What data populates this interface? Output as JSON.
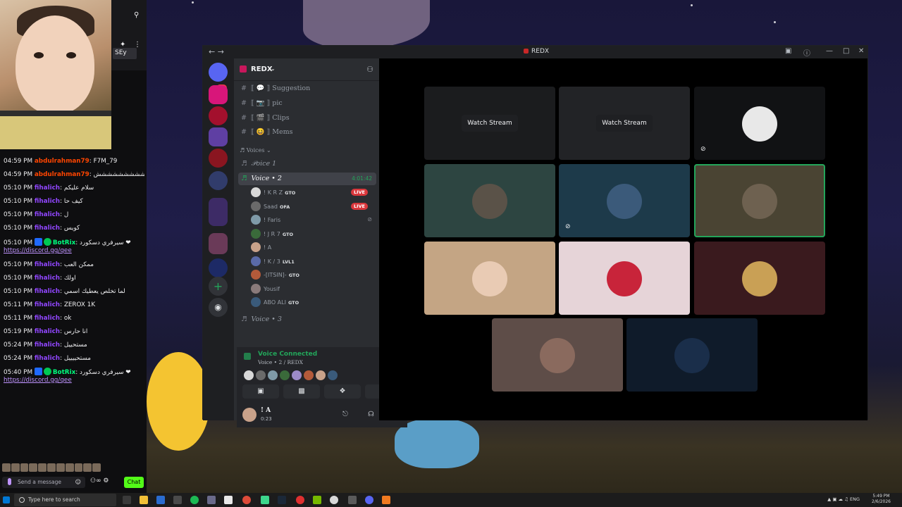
{
  "twitch_chat": {
    "messages": [
      {
        "time": "04:59 PM",
        "user": "abdulrahman79",
        "text": "F7M_79"
      },
      {
        "time": "04:59 PM",
        "user": "abdulrahman79",
        "text": "شششششششششششش"
      },
      {
        "time": "05:10 PM",
        "user": "fihalich",
        "text": "سلام عليكم"
      },
      {
        "time": "05:10 PM",
        "user": "fihalich",
        "text": "كيف حا"
      },
      {
        "time": "05:10 PM",
        "user": "fihalich",
        "text": "ل"
      },
      {
        "time": "05:10 PM",
        "user": "fihalich",
        "text": "كويس"
      },
      {
        "time": "05:10 PM",
        "user": "BotRix",
        "text": "سيرفري دسكورد ❤",
        "link": "https://discord.gg/qee"
      },
      {
        "time": "05:10 PM",
        "user": "fihalich",
        "text": "ممكن العب"
      },
      {
        "time": "05:10 PM",
        "user": "fihalich",
        "text": "اولك"
      },
      {
        "time": "05:10 PM",
        "user": "fihalich",
        "text": "لما تخلص يعطيك اسمي"
      },
      {
        "time": "05:11 PM",
        "user": "fihalich",
        "text": "ZEROX 1K"
      },
      {
        "time": "05:11 PM",
        "user": "fihalich",
        "text": "ok"
      },
      {
        "time": "05:19 PM",
        "user": "fihalich",
        "text": "انا حارس"
      },
      {
        "time": "05:24 PM",
        "user": "fihalich",
        "text": "مستحييل"
      },
      {
        "time": "05:24 PM",
        "user": "fihalich",
        "text": "مستحييييل"
      },
      {
        "time": "05:40 PM",
        "user": "BotRix",
        "text": "سيرفري دسكورد ❤",
        "link": "https://discord.gg/qee"
      }
    ],
    "send_placeholder": "Send a message",
    "chat_button": "Chat",
    "viewer_label": "SEy"
  },
  "discord": {
    "window_title": "REDX",
    "unread_count": "12",
    "server_name": "REDX",
    "text_channels": [
      {
        "name": "Suggestion",
        "prefix": "⟦ 💬 ⟧"
      },
      {
        "name": "pic",
        "prefix": "⟦ 📷 ⟧"
      },
      {
        "name": "Clips",
        "prefix": "⟦ 🎬 ⟧"
      },
      {
        "name": "Mems",
        "prefix": "⟦ 😆 ⟧"
      }
    ],
    "voice_category": "Voices",
    "voice_channels": [
      {
        "name": "𝒫𝑜𝑖𝑐𝑒 1",
        "label": "Voice • 1"
      },
      {
        "name": "Voice • 2",
        "duration": "4:01:42"
      },
      {
        "name": "Voice • 3"
      }
    ],
    "voice_users": [
      {
        "name": "! K R Z",
        "tag": "GTO",
        "live": "LIVE"
      },
      {
        "name": "Saad",
        "tag": "OFA",
        "live": "LIVE"
      },
      {
        "name": "! Faris",
        "tag": ""
      },
      {
        "name": "! J R 7",
        "tag": "GTO"
      },
      {
        "name": "! A",
        "tag": ""
      },
      {
        "name": "! K / 3",
        "tag": "LVL1"
      },
      {
        "name": "-[ITSIN]-",
        "tag": "GTO"
      },
      {
        "name": "Yousif",
        "tag": ""
      },
      {
        "name": "ABO ALI",
        "tag": "GTO"
      }
    ],
    "voice_panel": {
      "status": "Voice Connected",
      "location": "Voice • 2 / REDX"
    },
    "user": {
      "name": "! A",
      "status": "0:23"
    },
    "stage_tiles": [
      {
        "type": "stream",
        "label": "Watch Stream",
        "bg": "#1b1c1e"
      },
      {
        "type": "stream",
        "label": "Watch Stream",
        "bg": "#222326"
      },
      {
        "type": "user",
        "bg": "#111214",
        "avatar": "#e8e8e8",
        "muted": true
      },
      {
        "type": "user",
        "bg": "#2d4541",
        "avatar": "#5a5248"
      },
      {
        "type": "user",
        "bg": "#1d3a4a",
        "avatar": "#3b5a7a",
        "muted": true
      },
      {
        "type": "user",
        "bg": "#4a4433",
        "avatar": "#6e6150",
        "speaking": true
      },
      {
        "type": "user",
        "bg": "#c4a584",
        "avatar": "#e9cbb4"
      },
      {
        "type": "user",
        "bg": "#e6d4d8",
        "avatar": "#c8243a"
      },
      {
        "type": "user",
        "bg": "#3a1a1e",
        "avatar": "#c9a055"
      },
      {
        "type": "user",
        "bg": "#5e4d48",
        "avatar": "#8a6a5e"
      },
      {
        "type": "user",
        "bg": "#0f1b2a",
        "avatar": "#1a2e4a"
      }
    ]
  },
  "taskbar": {
    "search_placeholder": "Type here to search",
    "language": "ENG",
    "time": "5:49 PM",
    "date": "2/6/2026"
  },
  "colors": {
    "discord_green": "#23a55a",
    "live_red": "#da373c",
    "twitch_purple": "#9146ff",
    "kick_green": "#53fc18"
  }
}
